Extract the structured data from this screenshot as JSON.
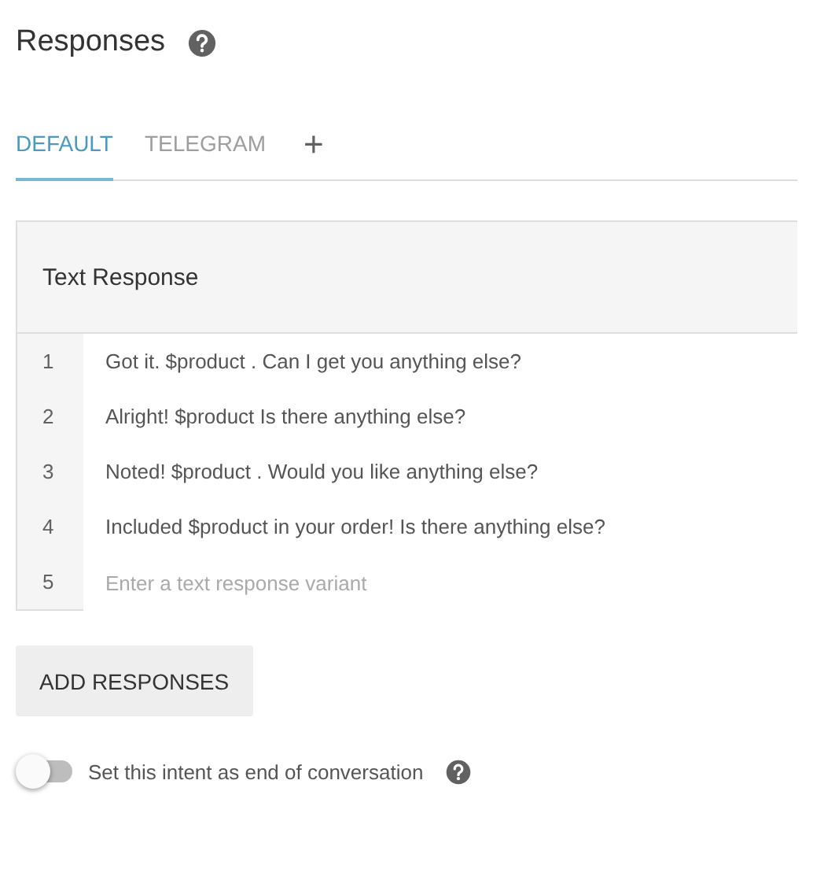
{
  "title": "Responses",
  "tabs": [
    {
      "label": "DEFAULT",
      "selected": true
    },
    {
      "label": "TELEGRAM",
      "selected": false
    }
  ],
  "add_tab": "+",
  "card": {
    "header": "Text Response",
    "rows": [
      {
        "number": "1",
        "kind": "text",
        "text": "Got it. $product . Can I get you anything else?"
      },
      {
        "number": "2",
        "kind": "text",
        "text": "Alright! $product Is there anything else?"
      },
      {
        "number": "3",
        "kind": "text",
        "text": "Noted! $product . Would you like anything else?"
      },
      {
        "number": "4",
        "kind": "text",
        "text": "Included $product in your order! Is there anything else?"
      },
      {
        "number": "5",
        "kind": "input",
        "placeholder": "Enter a text response variant"
      }
    ]
  },
  "add_button": "ADD RESPONSES",
  "end_toggle": {
    "label": "Set this intent as end of conversation",
    "on": false
  }
}
